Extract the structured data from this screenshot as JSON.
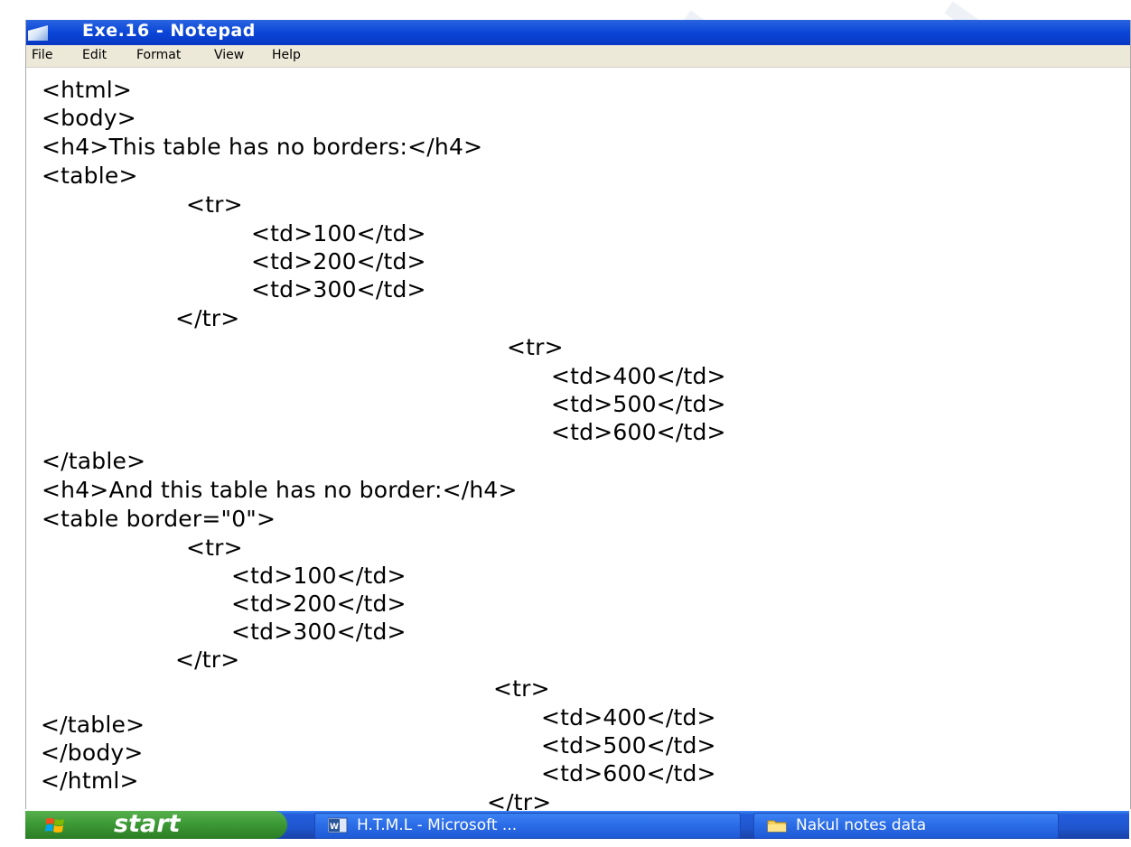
{
  "window": {
    "title": "Exe.16 - Notepad"
  },
  "menu": [
    "File",
    "Edit",
    "Format",
    "View",
    "Help"
  ],
  "code_lines": [
    "<html>",
    "<body>",
    "<h4>This table has no borders:</h4>",
    "<table>",
    "<tr>",
    "<td>100</td>",
    "<td>200</td>",
    "<td>300</td>",
    "</tr>",
    "<tr>",
    "<td>400</td>",
    "<td>500</td>",
    "<td>600</td>",
    "</table>",
    "<h4>And this table has no border:</h4>",
    "<table border=\"0\">",
    "<tr>",
    "<td>100</td>",
    "<td>200</td>",
    "<td>300</td>",
    "</tr>",
    "<tr>",
    "<td>400</td>",
    "<td>500</td>",
    "<td>600</td>",
    "</tr>",
    "</table>",
    "</body>",
    "</html>"
  ],
  "taskbar": {
    "start_label": "start",
    "items": [
      {
        "label": "H.T.M.L - Microsoft ...",
        "icon": "word-document-icon"
      },
      {
        "label": "Nakul notes data",
        "icon": "folder-icon"
      }
    ]
  },
  "colors": {
    "titlebar": "#0a46d8",
    "menubar": "#ece9d8",
    "taskbar": "#245edb",
    "start_button": "#3c9a35"
  }
}
